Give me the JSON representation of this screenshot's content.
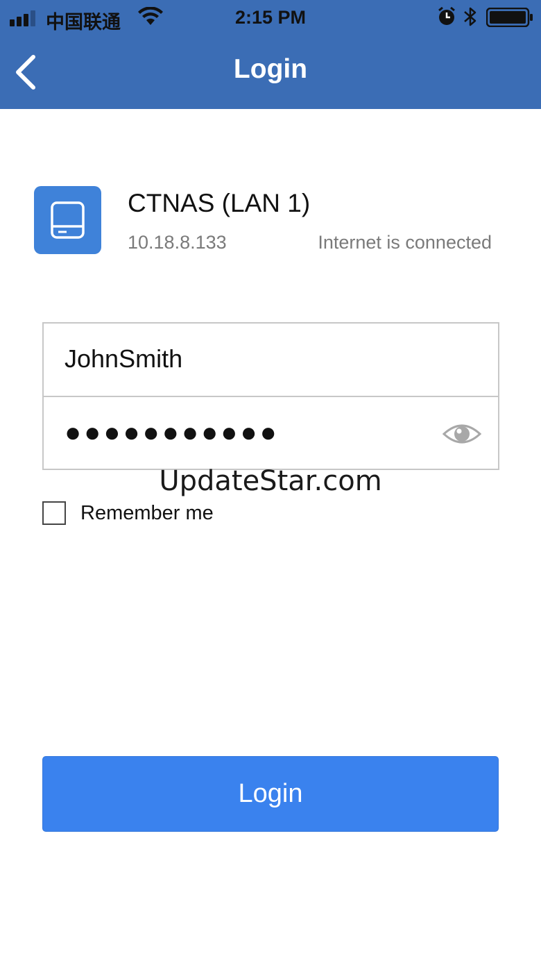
{
  "status_bar": {
    "carrier": "中国联通",
    "time": "2:15 PM",
    "icons": [
      "signal-icon",
      "wifi-icon",
      "alarm-icon",
      "bluetooth-icon",
      "battery-icon"
    ]
  },
  "nav": {
    "title": "Login",
    "back_icon": "chevron-left-icon"
  },
  "device": {
    "name": "CTNAS (LAN 1)",
    "ip": "10.18.8.133",
    "status": "Internet is connected",
    "icon": "drive-icon"
  },
  "form": {
    "username_value": "JohnSmith",
    "password_value": "●●●●●●●●●●●",
    "password_toggle_icon": "eye-icon",
    "remember_label": "Remember me",
    "remember_checked": false
  },
  "watermark": "UpdateStar.com",
  "login_button_label": "Login",
  "colors": {
    "header": "#3b6db5",
    "button": "#3a82ee",
    "device_icon": "#3f82d9"
  }
}
